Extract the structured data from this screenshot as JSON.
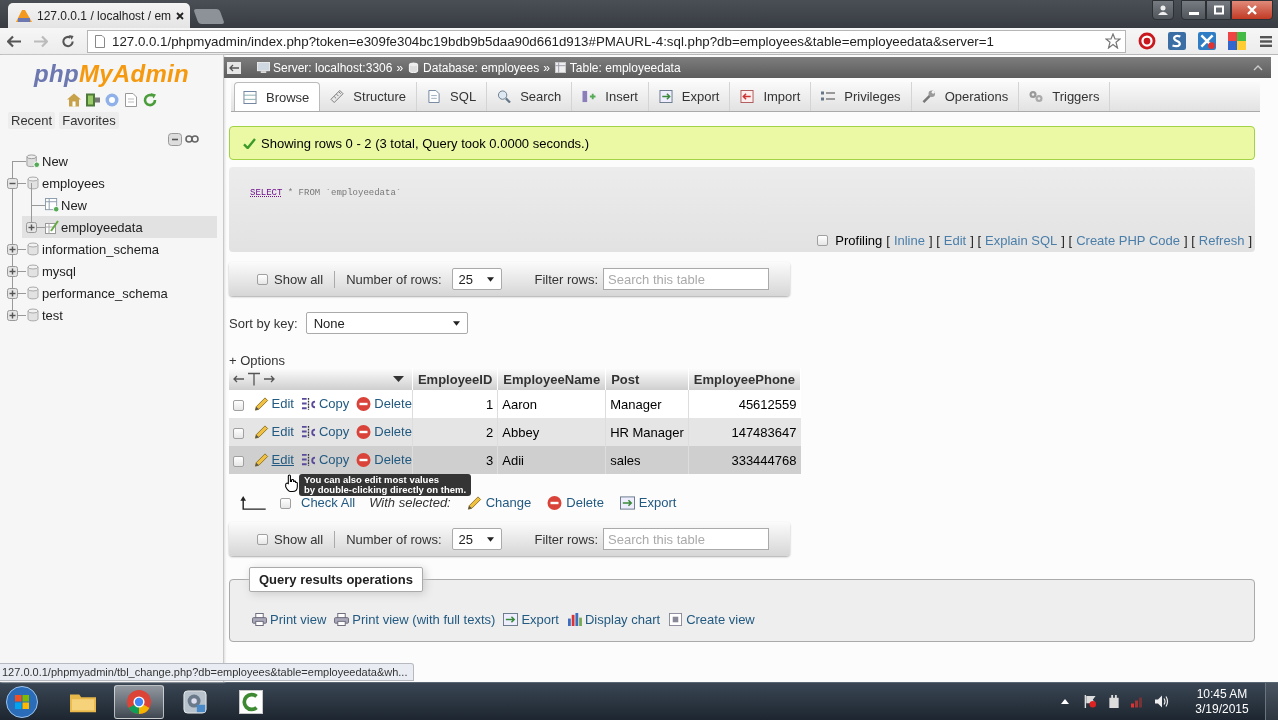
{
  "browser": {
    "tab": {
      "title": "127.0.0.1 / localhost / em"
    },
    "forward_disabled": true,
    "address": "127.0.0.1/phpmyadmin/index.php?token=e309fe304bc19bdb9b5daa90d661d913#PMAURL-4:sql.php?db=employees&table=employeedata&server=1",
    "status_url": "127.0.0.1/phpmyadmin/tbl_change.php?db=employees&table=employeedata&wh..."
  },
  "sidebar": {
    "logo": [
      "php",
      "MyAdmin"
    ],
    "buttons": [
      "Recent",
      "Favorites"
    ],
    "tree": [
      {
        "label": "New",
        "kind": "new",
        "selected": false
      },
      {
        "label": "employees",
        "kind": "database",
        "expanded": true,
        "selected": false,
        "children": [
          {
            "label": "New",
            "kind": "new",
            "selected": false
          },
          {
            "label": "employeedata",
            "kind": "table",
            "expanded": false,
            "selected": true
          }
        ]
      },
      {
        "label": "information_schema",
        "kind": "database",
        "expanded": false,
        "selected": false
      },
      {
        "label": "mysql",
        "kind": "database",
        "expanded": false,
        "selected": false
      },
      {
        "label": "performance_schema",
        "kind": "database",
        "expanded": false,
        "selected": false
      },
      {
        "label": "test",
        "kind": "database",
        "expanded": false,
        "selected": false
      }
    ]
  },
  "main": {
    "breadcrumb": [
      {
        "label": "Server: localhost:3306",
        "kind": "server",
        "separator": "»"
      },
      {
        "label": "Database: employees",
        "kind": "database",
        "separator": "»"
      },
      {
        "label": "Table: employeedata",
        "kind": "table"
      }
    ],
    "tabs": [
      {
        "label": "Browse",
        "kind": "browse",
        "selected": true
      },
      {
        "label": "Structure",
        "kind": "structure",
        "selected": false
      },
      {
        "label": "SQL",
        "kind": "sql",
        "selected": false
      },
      {
        "label": "Search",
        "kind": "search",
        "selected": false
      },
      {
        "label": "Insert",
        "kind": "insert",
        "selected": false
      },
      {
        "label": "Export",
        "kind": "export",
        "selected": false
      },
      {
        "label": "Import",
        "kind": "import",
        "selected": false
      },
      {
        "label": "Privileges",
        "kind": "privileges",
        "selected": false
      },
      {
        "label": "Operations",
        "kind": "operations",
        "selected": false
      },
      {
        "label": "Triggers",
        "kind": "triggers",
        "selected": false
      }
    ],
    "message": {
      "text": "Showing rows 0 - 2 (3 total, Query took 0.0000 seconds.)"
    },
    "sql": {
      "keyword": "SELECT",
      "rest": "* FROM `employeedata`"
    },
    "profiling": {
      "checked": false,
      "label": "Profiling",
      "items": [
        {
          "text": "[",
          "kind": "text"
        },
        {
          "text": "Inline",
          "kind": "link"
        },
        {
          "text": "] [",
          "kind": "text"
        },
        {
          "text": "Edit",
          "kind": "link"
        },
        {
          "text": "] [",
          "kind": "text"
        },
        {
          "text": "Explain SQL",
          "kind": "link"
        },
        {
          "text": "] [",
          "kind": "text"
        },
        {
          "text": "Create PHP Code",
          "kind": "link"
        },
        {
          "text": "] [",
          "kind": "text"
        },
        {
          "text": "Refresh",
          "kind": "link"
        },
        {
          "text": "]",
          "kind": "text"
        }
      ]
    },
    "navigation_top": {
      "show_all": {
        "label": "Show all",
        "checked": false
      },
      "rows_label": "Number of rows:",
      "rows_value": "25",
      "filter": {
        "label": "Filter rows:",
        "placeholder": "Search this table"
      }
    },
    "sort": {
      "label": "Sort by key:",
      "value": "None"
    },
    "options_link": "+ Options",
    "table": {
      "columns": [
        {
          "label": "EmployeeID",
          "kind": "number"
        },
        {
          "label": "EmployeeName",
          "kind": "text"
        },
        {
          "label": "Post",
          "kind": "text"
        },
        {
          "label": "EmployeePhone",
          "kind": "number"
        }
      ],
      "rows": [
        {
          "checked": false,
          "hovered": false,
          "actions": [
            {
              "label": "Edit",
              "kind": "edit"
            },
            {
              "label": "Copy",
              "kind": "copy"
            },
            {
              "label": "Delete",
              "kind": "delete"
            }
          ],
          "cells": [
            "1",
            "Aaron",
            "Manager",
            "45612559"
          ]
        },
        {
          "checked": false,
          "hovered": false,
          "actions": [
            {
              "label": "Edit",
              "kind": "edit"
            },
            {
              "label": "Copy",
              "kind": "copy"
            },
            {
              "label": "Delete",
              "kind": "delete"
            }
          ],
          "cells": [
            "2",
            "Abbey",
            "HR Manager",
            "147483647"
          ]
        },
        {
          "checked": false,
          "hovered": true,
          "actions": [
            {
              "label": "Edit",
              "kind": "edit"
            },
            {
              "label": "Copy",
              "kind": "copy"
            },
            {
              "label": "Delete",
              "kind": "delete"
            }
          ],
          "cells": [
            "3",
            "Adii",
            "sales",
            "333444768"
          ]
        }
      ]
    },
    "tooltip": {
      "lines": [
        "You can also edit most values",
        "by double-clicking directly on them."
      ]
    },
    "bulk": {
      "check_all": {
        "label": "Check All",
        "checked": false
      },
      "with_selected": "With selected:",
      "actions": [
        {
          "label": "Change",
          "kind": "change"
        },
        {
          "label": "Delete",
          "kind": "delete"
        },
        {
          "label": "Export",
          "kind": "export"
        }
      ]
    },
    "navigation_bottom": {
      "show_all": {
        "label": "Show all",
        "checked": false
      },
      "rows_label": "Number of rows:",
      "rows_value": "25",
      "filter": {
        "label": "Filter rows:",
        "placeholder": "Search this table"
      }
    },
    "operations": {
      "legend": "Query results operations",
      "actions": [
        {
          "label": "Print view",
          "kind": "print"
        },
        {
          "label": "Print view (with full texts)",
          "kind": "print"
        },
        {
          "label": "Export",
          "kind": "export"
        },
        {
          "label": "Display chart",
          "kind": "chart"
        },
        {
          "label": "Create view",
          "kind": "view"
        }
      ]
    }
  },
  "taskbar": {
    "apps": [
      {
        "kind": "folder",
        "active": false
      },
      {
        "kind": "browser",
        "active": true
      },
      {
        "kind": "tool",
        "active": false
      },
      {
        "kind": "editor",
        "active": false
      }
    ],
    "time": "10:45 AM",
    "date": "3/19/2015"
  }
}
